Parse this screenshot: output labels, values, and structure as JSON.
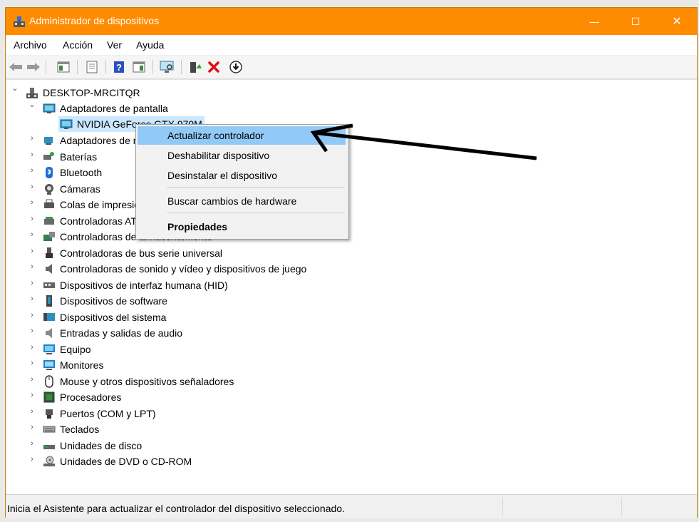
{
  "window": {
    "title": "Administrador de dispositivos",
    "controls": {
      "minimize": "—",
      "maximize": "☐",
      "close": "✕"
    }
  },
  "menubar": [
    "Archivo",
    "Acción",
    "Ver",
    "Ayuda"
  ],
  "toolbar": [
    {
      "name": "back-icon",
      "glyph": "⇦"
    },
    {
      "name": "forward-icon",
      "glyph": "⇨"
    },
    {
      "name": "show-hide-console-tree-icon",
      "glyph": "▦"
    },
    {
      "name": "properties-sheet-icon",
      "glyph": "▤"
    },
    {
      "name": "help-icon",
      "glyph": "?"
    },
    {
      "name": "action-pane-icon",
      "glyph": "▥"
    },
    {
      "name": "scan-hardware-icon",
      "glyph": "🖵"
    },
    {
      "name": "update-driver-icon",
      "glyph": "▲"
    },
    {
      "name": "uninstall-icon",
      "glyph": "✖"
    },
    {
      "name": "disable-device-icon",
      "glyph": "⬇"
    }
  ],
  "tree": {
    "root": "DESKTOP-MRCITQR",
    "expanded_category": "Adaptadores de pantalla",
    "selected_device": "NVIDIA GeForce GTX 970M",
    "categories": [
      "Adaptadores de red",
      "Baterías",
      "Bluetooth",
      "Cámaras",
      "Colas de impresión",
      "Controladoras ATA/ATAPI IDE",
      "Controladoras de almacenamiento",
      "Controladoras de bus serie universal",
      "Controladoras de sonido y vídeo y dispositivos de juego",
      "Dispositivos de interfaz humana (HID)",
      "Dispositivos de software",
      "Dispositivos del sistema",
      "Entradas y salidas de audio",
      "Equipo",
      "Monitores",
      "Mouse y otros dispositivos señaladores",
      "Procesadores",
      "Puertos (COM y LPT)",
      "Teclados",
      "Unidades de disco",
      "Unidades de DVD o CD-ROM"
    ]
  },
  "context_menu": {
    "items": [
      "Actualizar controlador",
      "Deshabilitar dispositivo",
      "Desinstalar el dispositivo",
      "Buscar cambios de hardware",
      "Propiedades"
    ],
    "highlighted": "Actualizar controlador"
  },
  "status": "Inicia el Asistente para actualizar el controlador del dispositivo seleccionado.",
  "colors": {
    "titlebar": "#ff8c00",
    "selection": "#cce8ff",
    "menu_highlight": "#91c9f7"
  }
}
